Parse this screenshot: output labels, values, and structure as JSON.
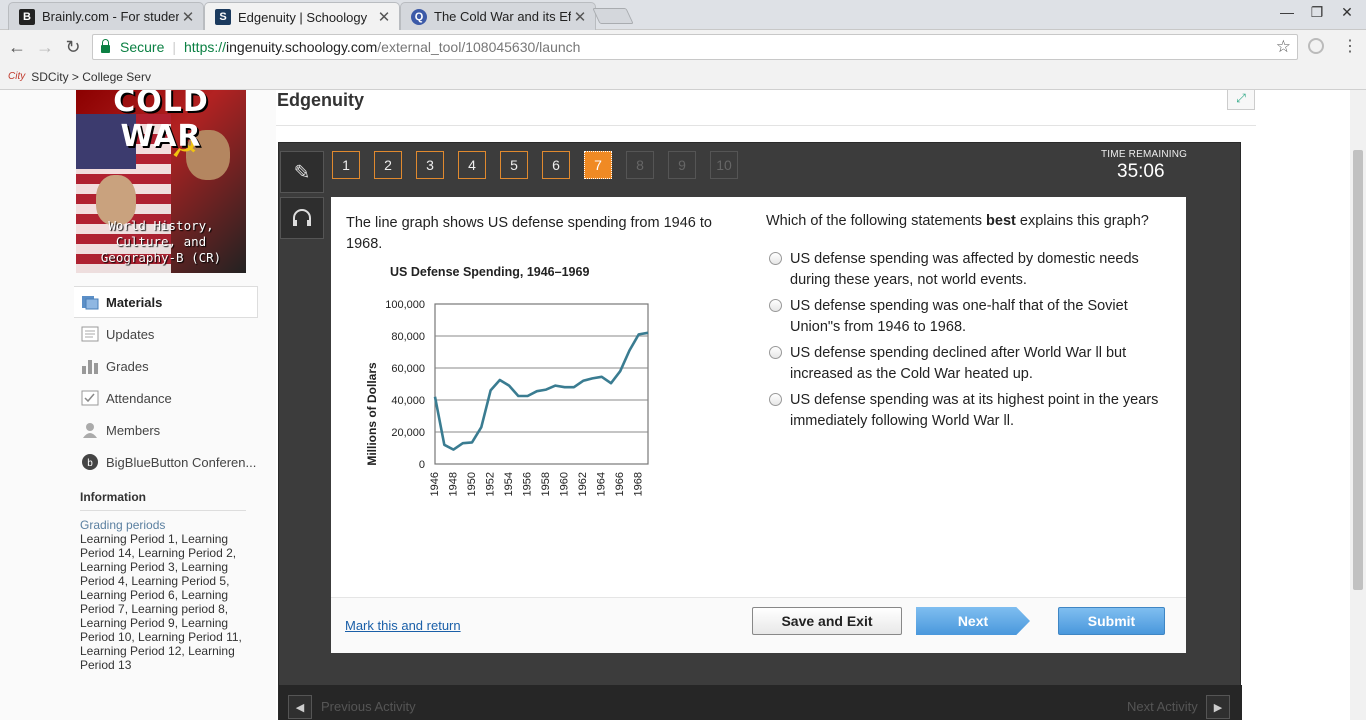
{
  "browser": {
    "tabs": [
      {
        "title": "Brainly.com - For studen",
        "favicon": "B",
        "favicon_color": "#222222"
      },
      {
        "title": "Edgenuity | Schoology",
        "favicon": "S",
        "favicon_color": "#1b3a5e"
      },
      {
        "title": "The Cold War and its Eff",
        "favicon": "Q",
        "favicon_color": "#3c5aa8"
      }
    ],
    "secure_label": "Secure",
    "url_scheme": "https://",
    "url_host": "ingenuity.schoology.com",
    "url_path": "/external_tool/108045630/launch",
    "bookmark_icon": "City",
    "bookmark_label": "SDCity > College Serv"
  },
  "cover": {
    "title": "COLD WAR",
    "subtitle_lines": [
      "World History,",
      "Culture, and",
      "Geography-B (CR)"
    ]
  },
  "sidebar": {
    "items": [
      {
        "label": "Materials",
        "icon": "materials-icon"
      },
      {
        "label": "Updates",
        "icon": "updates-icon"
      },
      {
        "label": "Grades",
        "icon": "grades-icon"
      },
      {
        "label": "Attendance",
        "icon": "attendance-icon"
      },
      {
        "label": "Members",
        "icon": "members-icon"
      },
      {
        "label": "BigBlueButton Conferen...",
        "icon": "bigbluebutton-icon"
      }
    ],
    "info_heading": "Information",
    "grading_label": "Grading periods",
    "grading_text": "Learning Period 1, Learning Period 14, Learning Period 2, Learning Period 3, Learning Period 4, Learning Period 5, Learning Period 6, Learning Period 7, Learning period 8, Learning Period 9, Learning Period 10, Learning Period 11, Learning Period 12, Learning Period 13"
  },
  "main": {
    "title": "Edgenuity"
  },
  "player": {
    "question_numbers": [
      "1",
      "2",
      "3",
      "4",
      "5",
      "6",
      "7",
      "8",
      "9",
      "10"
    ],
    "current_question": "7",
    "timer_label": "TIME REMAINING",
    "timer_value": "35:06",
    "prompt": "The line graph shows US defense spending from 1946 to 1968.",
    "question_pre": "Which of the following statements ",
    "question_bold": "best",
    "question_post": " explains this graph?",
    "choices": [
      "US defense spending was affected by domestic needs during these years, not world events.",
      "US defense spending was one-half that of the Soviet Union\"s from 1946 to 1968.",
      "US defense spending declined after World War ll but increased as the Cold War heated up.",
      "US defense spending was at its highest point in the years immediately following World War ll."
    ],
    "mark_link": "Mark this and return",
    "save_exit": "Save and Exit",
    "next": "Next",
    "submit": "Submit",
    "prev_activity": "Previous Activity",
    "next_activity": "Next Activity"
  },
  "chart_data": {
    "type": "line",
    "title": "US Defense Spending, 1946–1969",
    "ylabel": "Millions of Dollars",
    "xlabel": "",
    "xlim": [
      1946,
      1969
    ],
    "ylim": [
      0,
      100000
    ],
    "yticks": [
      0,
      20000,
      40000,
      60000,
      80000,
      100000
    ],
    "ytick_labels": [
      "0",
      "20,000",
      "40,000",
      "60,000",
      "80,000",
      "100,000"
    ],
    "xticks": [
      1946,
      1948,
      1950,
      1952,
      1954,
      1956,
      1958,
      1960,
      1962,
      1964,
      1966,
      1968
    ],
    "gridlines": [
      20000,
      40000,
      60000,
      80000
    ],
    "line_color": "#3a7c91",
    "series": [
      {
        "x": [
          1946,
          1947,
          1948,
          1949,
          1950,
          1951,
          1952,
          1953,
          1954,
          1955,
          1956,
          1957,
          1958,
          1959,
          1960,
          1961,
          1962,
          1963,
          1964,
          1965,
          1966,
          1967,
          1968,
          1969
        ],
        "values": [
          42000,
          12000,
          9000,
          13000,
          13500,
          23000,
          46000,
          52500,
          49000,
          42500,
          42500,
          45500,
          46500,
          49000,
          48000,
          48000,
          52000,
          53500,
          54500,
          50500,
          58000,
          71000,
          81000,
          82000
        ]
      }
    ]
  }
}
